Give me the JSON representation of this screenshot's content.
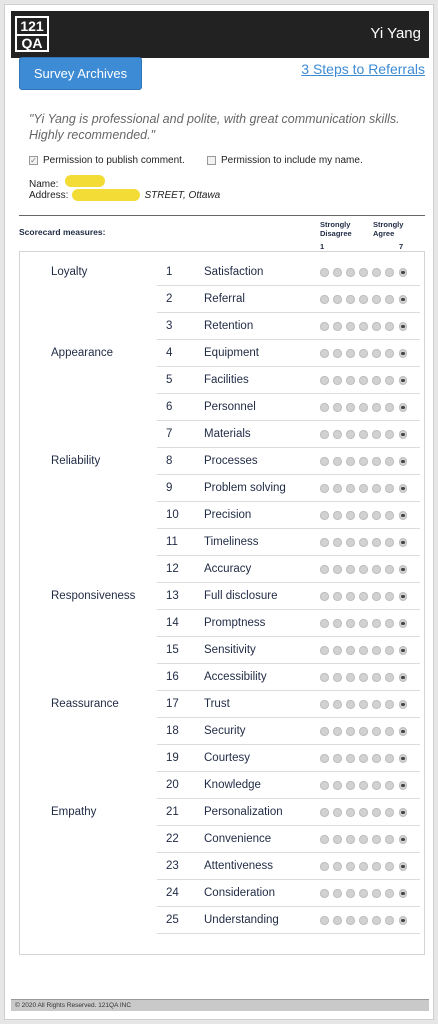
{
  "header": {
    "logo_line1": "121",
    "logo_line2": "QA",
    "user_name": "Yi Yang"
  },
  "nav": {
    "archives_label": "Survey Archives",
    "referrals_label": "3 Steps to Referrals"
  },
  "testimonial": {
    "comment": "\"Yi Yang is professional and polite, with great communication skills. Highly recommended.\"",
    "permission_publish_label": "Permission to publish comment.",
    "permission_publish_checked": true,
    "permission_name_label": "Permission to include my name.",
    "permission_name_checked": false,
    "name_label": "Name:",
    "address_label": "Address:",
    "address_visible_text": "STREET, Ottawa"
  },
  "scorecard": {
    "title": "Scorecard measures:",
    "scale_low_label": "Strongly Disagree",
    "scale_high_label": "Strongly Agree",
    "scale_low_num": "1",
    "scale_high_num": "7",
    "colors": {
      "radio_fill": "#d2d2d2",
      "radio_selected_dot": "#444444"
    },
    "rows": [
      {
        "category": "Loyalty",
        "num": "1",
        "measure": "Satisfaction",
        "rating": 7
      },
      {
        "category": "",
        "num": "2",
        "measure": "Referral",
        "rating": 7
      },
      {
        "category": "",
        "num": "3",
        "measure": "Retention",
        "rating": 7
      },
      {
        "category": "Appearance",
        "num": "4",
        "measure": "Equipment",
        "rating": 7
      },
      {
        "category": "",
        "num": "5",
        "measure": "Facilities",
        "rating": 7
      },
      {
        "category": "",
        "num": "6",
        "measure": "Personnel",
        "rating": 7
      },
      {
        "category": "",
        "num": "7",
        "measure": "Materials",
        "rating": 7
      },
      {
        "category": "Reliability",
        "num": "8",
        "measure": "Processes",
        "rating": 7
      },
      {
        "category": "",
        "num": "9",
        "measure": "Problem solving",
        "rating": 7
      },
      {
        "category": "",
        "num": "10",
        "measure": "Precision",
        "rating": 7
      },
      {
        "category": "",
        "num": "11",
        "measure": "Timeliness",
        "rating": 7
      },
      {
        "category": "",
        "num": "12",
        "measure": "Accuracy",
        "rating": 7
      },
      {
        "category": "Responsiveness",
        "num": "13",
        "measure": "Full disclosure",
        "rating": 7
      },
      {
        "category": "",
        "num": "14",
        "measure": "Promptness",
        "rating": 7
      },
      {
        "category": "",
        "num": "15",
        "measure": "Sensitivity",
        "rating": 7
      },
      {
        "category": "",
        "num": "16",
        "measure": "Accessibility",
        "rating": 7
      },
      {
        "category": "Reassurance",
        "num": "17",
        "measure": "Trust",
        "rating": 7
      },
      {
        "category": "",
        "num": "18",
        "measure": "Security",
        "rating": 7
      },
      {
        "category": "",
        "num": "19",
        "measure": "Courtesy",
        "rating": 7
      },
      {
        "category": "",
        "num": "20",
        "measure": "Knowledge",
        "rating": 7
      },
      {
        "category": "Empathy",
        "num": "21",
        "measure": "Personalization",
        "rating": 7
      },
      {
        "category": "",
        "num": "22",
        "measure": "Convenience",
        "rating": 7
      },
      {
        "category": "",
        "num": "23",
        "measure": "Attentiveness",
        "rating": 7
      },
      {
        "category": "",
        "num": "24",
        "measure": "Consideration",
        "rating": 7
      },
      {
        "category": "",
        "num": "25",
        "measure": "Understanding",
        "rating": 7
      }
    ]
  },
  "footer": {
    "text": "© 2020 All Rights Reserved. 121QA INC"
  }
}
